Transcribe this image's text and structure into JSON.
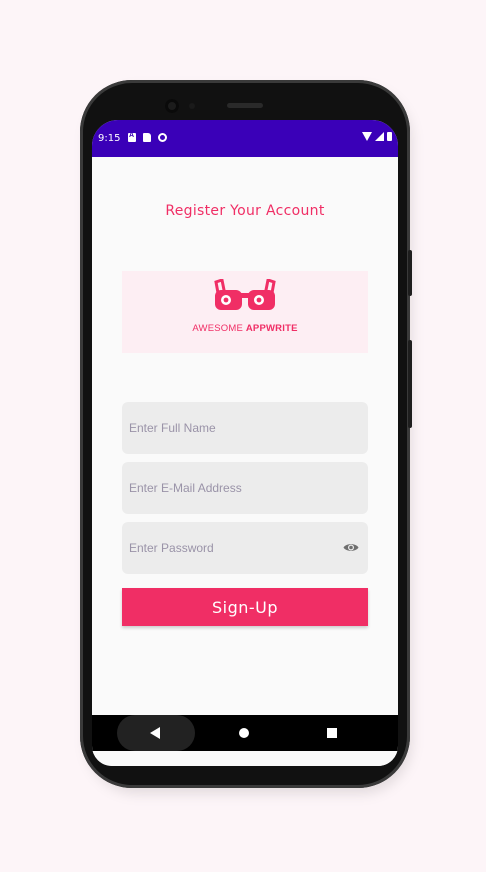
{
  "status_bar": {
    "time": "9:15",
    "background": "#3a00b8"
  },
  "screen": {
    "title": "Register Your Account",
    "logo": {
      "brand_light": "AWESOME ",
      "brand_bold": "APPWRITE",
      "icon": "glasses-logo-icon"
    },
    "fields": {
      "full_name_placeholder": "Enter Full Name",
      "email_placeholder": "Enter E-Mail Address",
      "password_placeholder": "Enter Password",
      "password_toggle_icon": "eye-icon"
    },
    "signup_label": "Sign-Up"
  },
  "nav_bar": {
    "back_icon": "back-triangle-icon",
    "home_icon": "home-circle-icon",
    "recent_icon": "recents-square-icon"
  },
  "colors": {
    "accent": "#f02e65",
    "page_bg": "#fdf5f8",
    "field_bg": "#ececec",
    "logo_bg": "#fdeef3"
  }
}
